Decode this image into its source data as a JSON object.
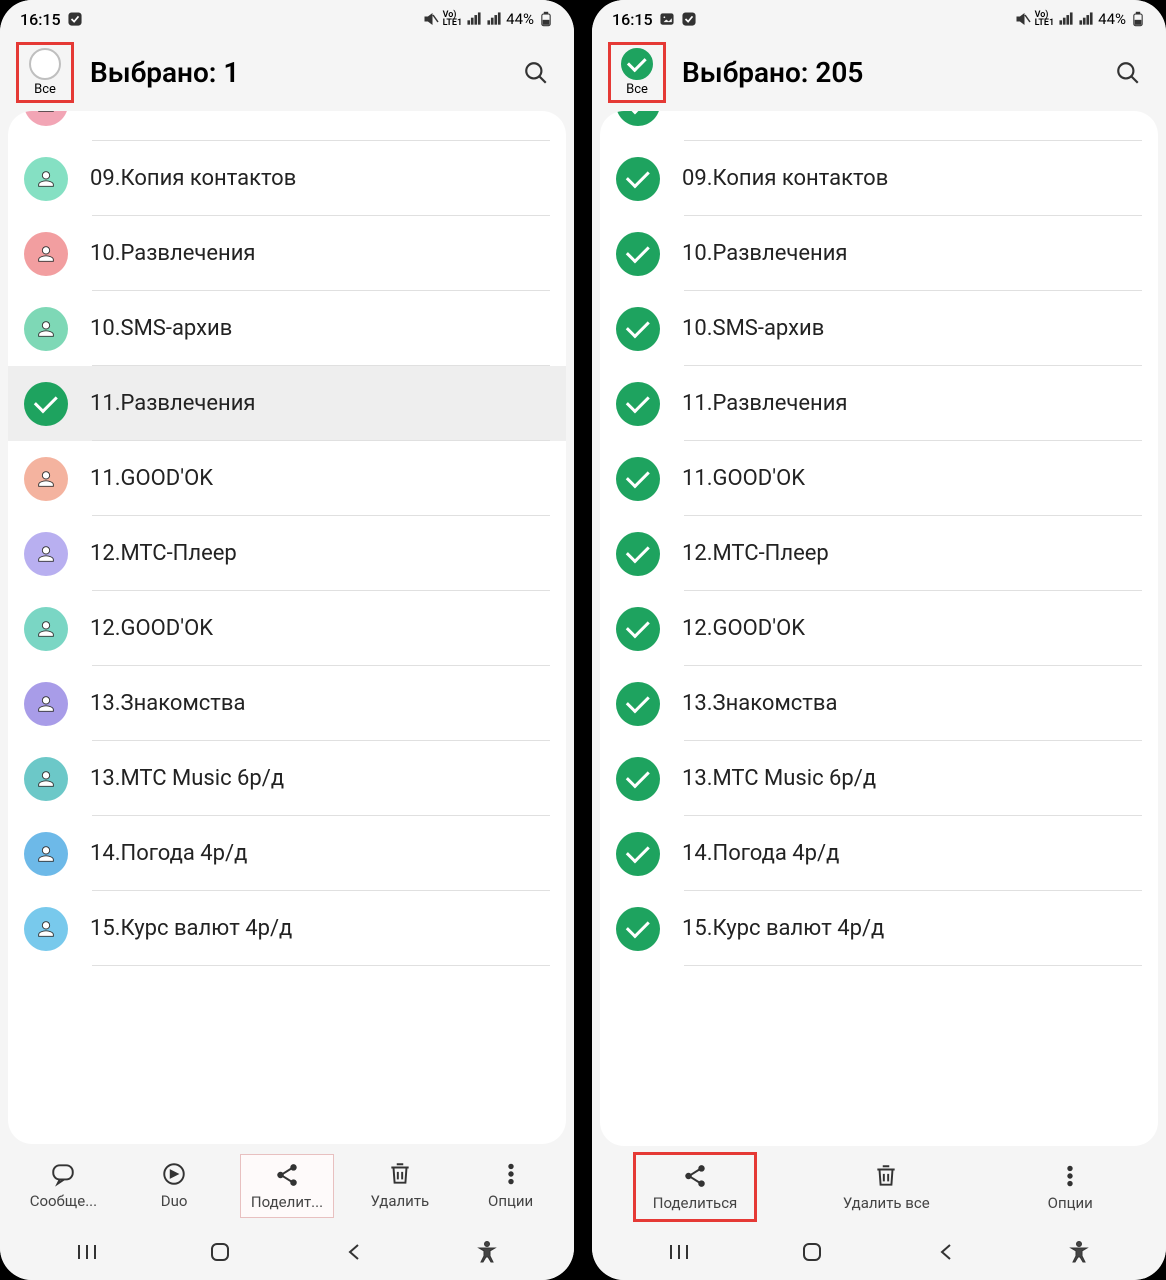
{
  "status": {
    "time": "16:15",
    "battery": "44%",
    "lte_label": "Vo)\nLTE1"
  },
  "header": {
    "all_label": "Все"
  },
  "left": {
    "title": "Выбрано: 1",
    "all_checked": false,
    "contacts": [
      {
        "name": "",
        "color": "#f2a5b5",
        "checked": false,
        "partial": true
      },
      {
        "name": "09.Копия контактов",
        "color": "#85e0c3",
        "checked": false
      },
      {
        "name": "10.Развлечения",
        "color": "#f29ea0",
        "checked": false
      },
      {
        "name": "10.SMS-архив",
        "color": "#7ed8b6",
        "checked": false
      },
      {
        "name": "11.Развлечения",
        "color": "#1ea35f",
        "checked": true,
        "selected": true
      },
      {
        "name": "11.GOOD'OK",
        "color": "#f4b39f",
        "checked": false
      },
      {
        "name": "12.МТС-Плеер",
        "color": "#b8aff0",
        "checked": false
      },
      {
        "name": "12.GOOD'OK",
        "color": "#7ad6c4",
        "checked": false
      },
      {
        "name": "13.Знакомства",
        "color": "#a89ce8",
        "checked": false
      },
      {
        "name": "13.MTC Music 6р/д",
        "color": "#6cc8c8",
        "checked": false
      },
      {
        "name": "14.Погода 4р/д",
        "color": "#6db9e8",
        "checked": false
      },
      {
        "name": "15.Курс валют 4р/д",
        "color": "#78c9ec",
        "checked": false
      }
    ],
    "bottom_buttons": [
      {
        "label": "Сообще...",
        "icon": "message"
      },
      {
        "label": "Duo",
        "icon": "duo"
      },
      {
        "label": "Поделит...",
        "icon": "share"
      },
      {
        "label": "Удалить",
        "icon": "delete"
      },
      {
        "label": "Опции",
        "icon": "more"
      }
    ]
  },
  "right": {
    "title": "Выбрано: 205",
    "all_checked": true,
    "contacts": [
      {
        "name": "",
        "checked": true,
        "partial": true
      },
      {
        "name": "09.Копия контактов",
        "checked": true
      },
      {
        "name": "10.Развлечения",
        "checked": true
      },
      {
        "name": "10.SMS-архив",
        "checked": true
      },
      {
        "name": "11.Развлечения",
        "checked": true
      },
      {
        "name": "11.GOOD'OK",
        "checked": true
      },
      {
        "name": "12.МТС-Плеер",
        "checked": true
      },
      {
        "name": "12.GOOD'OK",
        "checked": true
      },
      {
        "name": "13.Знакомства",
        "checked": true
      },
      {
        "name": "13.MTC Music 6р/д",
        "checked": true
      },
      {
        "name": "14.Погода 4р/д",
        "checked": true
      },
      {
        "name": "15.Курс валют 4р/д",
        "checked": true
      }
    ],
    "bottom_buttons": [
      {
        "label": "Поделиться",
        "icon": "share"
      },
      {
        "label": "Удалить все",
        "icon": "delete"
      },
      {
        "label": "Опции",
        "icon": "more"
      }
    ]
  }
}
